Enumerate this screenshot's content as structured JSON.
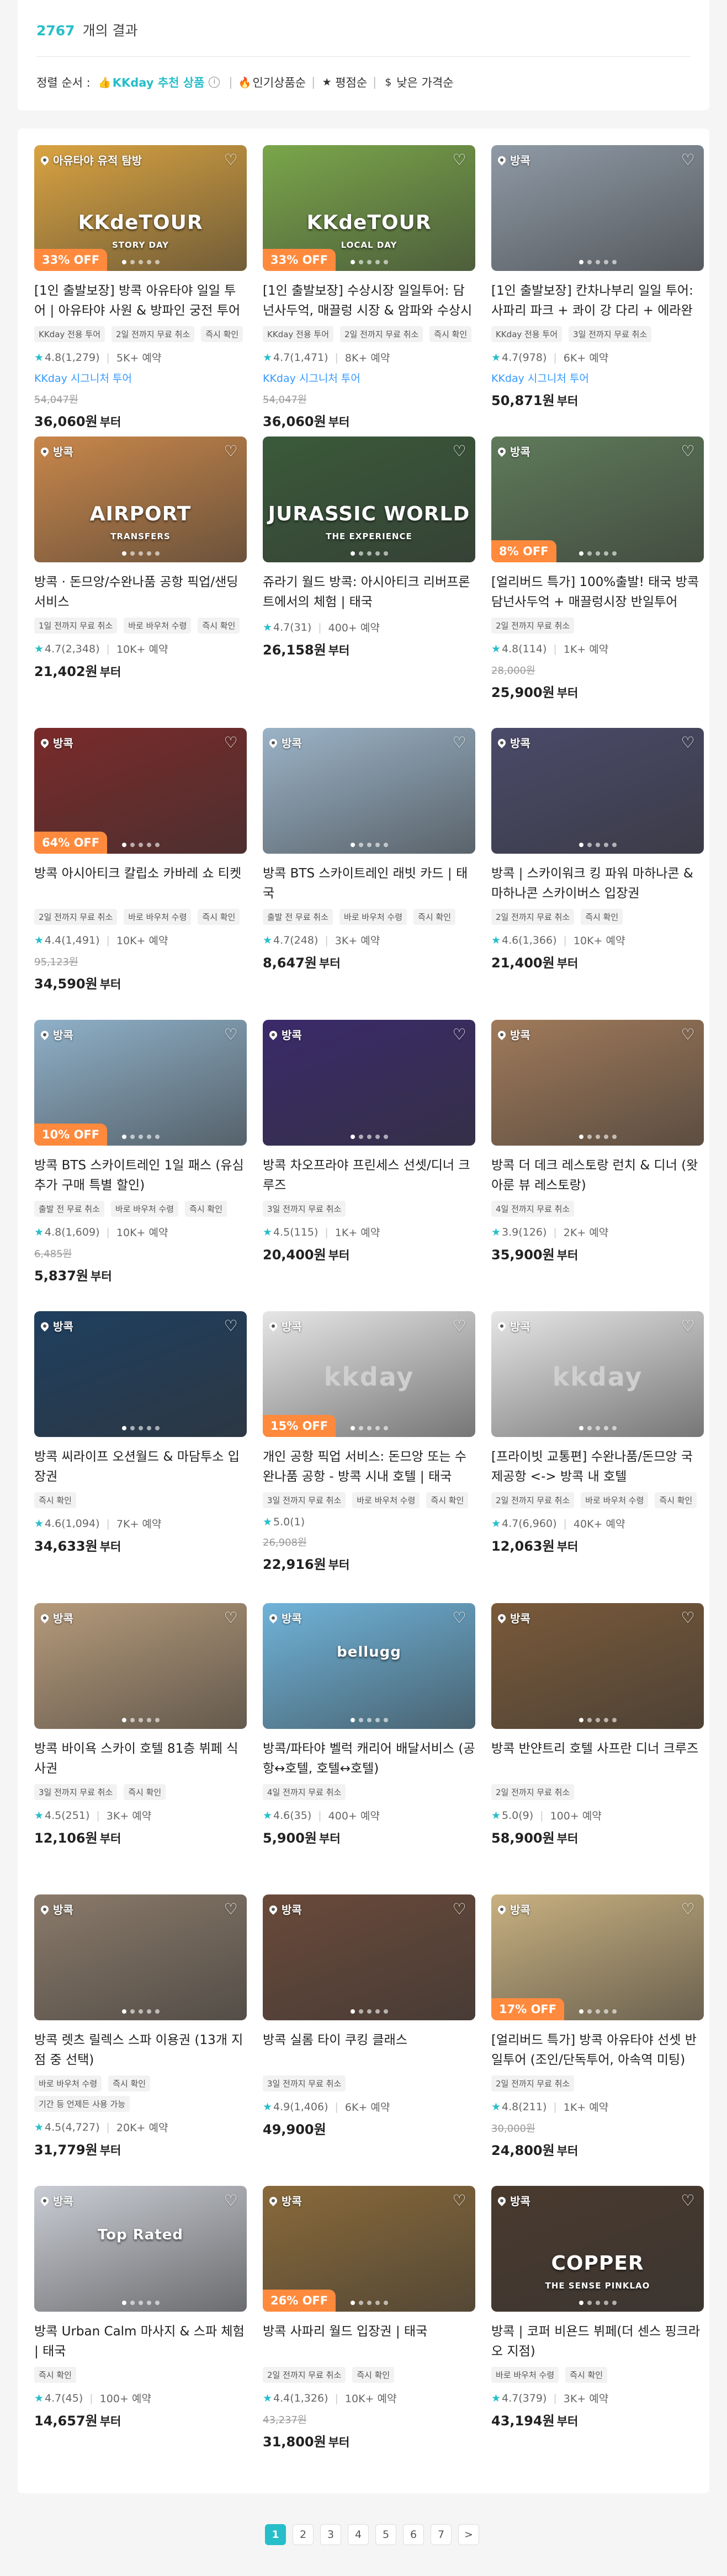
{
  "results": {
    "count": "2767",
    "label": "개의 결과"
  },
  "sort": {
    "label": "정렬 순서 :",
    "options": [
      {
        "label": "KKday 추천 상품",
        "glyph": "👍",
        "active": true
      },
      {
        "label": "인기상품순",
        "glyph": "🔥"
      },
      {
        "label": "평점순",
        "glyph": "★"
      },
      {
        "label": "낮은 가격순",
        "glyph": "$"
      }
    ]
  },
  "colors": {
    "accent": "#26bec9",
    "signature": "#3399ff",
    "discount": "#ff8a3d"
  },
  "products": [
    {
      "loc": "아유타야 유적 탐방",
      "off": "33% OFF",
      "img_text": "KKdeTOUR",
      "img_sub": "STORY DAY",
      "bg": "#d9a341",
      "title": "[1인 출발보장] 방콕 아유타야 일일 투어 | 아유타야 사원 & 방파인 궁전 투어",
      "tags": [
        "KKday 전용 투어",
        "2일 전까지 무료 취소",
        "즉시 확인"
      ],
      "rating": "4.8(1,279)",
      "booked": "5K+ 예약",
      "signature": "KKday 시그니처 투어",
      "old_price": "54,047원",
      "price": "36,060원",
      "unit": "부터"
    },
    {
      "loc": "",
      "off": "33% OFF",
      "img_text": "KKdeTOUR",
      "img_sub": "LOCAL DAY",
      "bg": "#7aa64a",
      "title": "[1인 출발보장] 수상시장 일일투어: 담넌사두억, 매끌렁 시장 & 암파와 수상시장",
      "tags": [
        "KKday 전용 투어",
        "2일 전까지 무료 취소",
        "즉시 확인"
      ],
      "rating": "4.7(1,471)",
      "booked": "8K+ 예약",
      "signature": "KKday 시그니처 투어",
      "old_price": "54,047원",
      "price": "36,060원",
      "unit": "부터"
    },
    {
      "loc": "방콕",
      "off": "",
      "img_text": "",
      "img_sub": "",
      "bg": "#8f9aa6",
      "title": "[1인 출발보장] 칸차나부리 일일 투어: 사파리 파크 + 콰이 강 다리 + 에라완 폭포",
      "tags": [
        "KKday 전용 투어",
        "3일 전까지 무료 취소"
      ],
      "rating": "4.7(978)",
      "booked": "6K+ 예약",
      "signature": "KKday 시그니처 투어",
      "old_price": "",
      "price": "50,871원",
      "unit": "부터"
    },
    {
      "loc": "방콕",
      "off": "",
      "img_text": "AIRPORT",
      "img_sub": "TRANSFERS",
      "bg": "#c9874a",
      "title": "방콕 · 돈므앙/수완나품 공항 픽업/샌딩 서비스",
      "tags": [
        "1일 전까지 무료 취소",
        "바로 바우처 수령",
        "즉시 확인"
      ],
      "rating": "4.7(2,348)",
      "booked": "10K+ 예약",
      "signature": "",
      "old_price": "",
      "price": "21,402원",
      "unit": "부터"
    },
    {
      "loc": "",
      "off": "",
      "img_text": "JURASSIC WORLD",
      "img_sub": "THE EXPERIENCE",
      "bg": "#3a5a3a",
      "title": "쥬라기 월드 방콕: 아시아티크 리버프론트에서의 체험 | 태국",
      "tags": [],
      "rating": "4.7(31)",
      "booked": "400+ 예약",
      "signature": "",
      "old_price": "",
      "price": "26,158원",
      "unit": "부터"
    },
    {
      "loc": "방콕",
      "off": "8% OFF",
      "img_text": "",
      "img_sub": "",
      "bg": "#5f7a5a",
      "title": "[얼리버드 특가] 100%출발! 태국 방콕 담넌사두억 + 매끌렁시장 반일투어",
      "tags": [
        "2일 전까지 무료 취소"
      ],
      "rating": "4.8(114)",
      "booked": "1K+ 예약",
      "signature": "",
      "old_price": "28,000원",
      "price": "25,900원",
      "unit": "부터"
    },
    {
      "loc": "방콕",
      "off": "64% OFF",
      "img_text": "",
      "img_sub": "",
      "bg": "#7a2a2a",
      "title": "방콕 아시아티크 칼립소 카바레 쇼 티켓",
      "tags": [
        "2일 전까지 무료 취소",
        "바로 바우처 수령",
        "즉시 확인"
      ],
      "rating": "4.4(1,491)",
      "booked": "10K+ 예약",
      "signature": "",
      "old_price": "95,123원",
      "price": "34,590원",
      "unit": "부터"
    },
    {
      "loc": "방콕",
      "off": "",
      "img_text": "",
      "img_sub": "",
      "bg": "#9bb3c7",
      "title": "방콕 BTS 스카이트레인 래빗 카드 | 태국",
      "tags": [
        "출발 전 무료 취소",
        "바로 바우처 수령",
        "즉시 확인"
      ],
      "rating": "4.7(248)",
      "booked": "3K+ 예약",
      "signature": "",
      "old_price": "",
      "price": "8,647원",
      "unit": "부터"
    },
    {
      "loc": "방콕",
      "off": "",
      "img_text": "",
      "img_sub": "",
      "bg": "#4a4a6a",
      "title": "방콕 | 스카이워크 킹 파워 마하나콘 & 마하나콘 스카이버스 입장권",
      "tags": [
        "2일 전까지 무료 취소",
        "즉시 확인"
      ],
      "rating": "4.6(1,366)",
      "booked": "10K+ 예약",
      "signature": "",
      "old_price": "",
      "price": "21,400원",
      "unit": "부터"
    },
    {
      "loc": "방콕",
      "off": "10% OFF",
      "img_text": "",
      "img_sub": "",
      "bg": "#8fb0c8",
      "title": "방콕 BTS 스카이트레인 1일 패스 (유심 추가 구매 특별 할인)",
      "tags": [
        "출발 전 무료 취소",
        "바로 바우처 수령",
        "즉시 확인"
      ],
      "rating": "4.8(1,609)",
      "booked": "10K+ 예약",
      "signature": "",
      "old_price": "6,485원",
      "price": "5,837원",
      "unit": "부터"
    },
    {
      "loc": "방콕",
      "off": "",
      "img_text": "",
      "img_sub": "",
      "bg": "#3a2a6a",
      "title": "방콕 차오프라야 프린세스 선셋/디너 크루즈",
      "tags": [
        "3일 전까지 무료 취소"
      ],
      "rating": "4.5(115)",
      "booked": "1K+ 예약",
      "signature": "",
      "old_price": "",
      "price": "20,400원",
      "unit": "부터"
    },
    {
      "loc": "방콕",
      "off": "",
      "img_text": "",
      "img_sub": "",
      "bg": "#a07a5a",
      "title": "방콕 더 데크 레스토랑 런치 & 디너 (왓아룬 뷰 레스토랑)",
      "tags": [
        "4일 전까지 무료 취소"
      ],
      "rating": "3.9(126)",
      "booked": "2K+ 예약",
      "signature": "",
      "old_price": "",
      "price": "35,900원",
      "unit": "부터"
    },
    {
      "loc": "방콕",
      "off": "",
      "img_text": "",
      "img_sub": "",
      "bg": "#1f3f5f",
      "title": "방콕 씨라이프 오션월드 & 마담투소 입장권",
      "tags": [
        "즉시 확인"
      ],
      "rating": "4.6(1,094)",
      "booked": "7K+ 예약",
      "signature": "",
      "old_price": "",
      "price": "34,633원",
      "unit": "부터"
    },
    {
      "loc": "방콕",
      "off": "15% OFF",
      "img_text": "kkday",
      "img_sub": "",
      "bg": "#e6e6e6",
      "title": "개인 공항 픽업 서비스: 돈므앙 또는 수완나품 공항 - 방콕 시내 호텔 | 태국",
      "tags": [
        "3일 전까지 무료 취소",
        "바로 바우처 수령",
        "즉시 확인"
      ],
      "rating": "5.0(1)",
      "booked": "",
      "signature": "",
      "old_price": "26,908원",
      "price": "22,916원",
      "unit": "부터"
    },
    {
      "loc": "방콕",
      "off": "",
      "img_text": "kkday",
      "img_sub": "",
      "bg": "#e6e6e6",
      "title": "[프라이빗 교통편] 수완나품/돈므앙 국제공항 <-> 방콕 내 호텔",
      "tags": [
        "2일 전까지 무료 취소",
        "바로 바우처 수령",
        "즉시 확인"
      ],
      "rating": "4.7(6,960)",
      "booked": "40K+ 예약",
      "signature": "",
      "old_price": "",
      "price": "12,063원",
      "unit": "부터"
    },
    {
      "loc": "방콕",
      "off": "",
      "img_text": "",
      "img_sub": "",
      "bg": "#b59a7a",
      "title": "방콕 바이욕 스카이 호텔 81층 뷔페 식사권",
      "tags": [
        "3일 전까지 무료 취소",
        "즉시 확인"
      ],
      "rating": "4.5(251)",
      "booked": "3K+ 예약",
      "signature": "",
      "old_price": "",
      "price": "12,106원",
      "unit": "부터"
    },
    {
      "loc": "방콕",
      "off": "",
      "img_text": "bellugg",
      "img_sub": "",
      "bg": "#6fb3d9",
      "title": "방콕/파타야 벨럭 캐리어 배달서비스 (공항↔호텔, 호텔↔호텔)",
      "tags": [
        "4일 전까지 무료 취소"
      ],
      "rating": "4.6(35)",
      "booked": "400+ 예약",
      "signature": "",
      "old_price": "",
      "price": "5,900원",
      "unit": "부터"
    },
    {
      "loc": "방콕",
      "off": "",
      "img_text": "",
      "img_sub": "",
      "bg": "#7a5a3a",
      "title": "방콕 반얀트리 호텔 사프란 디너 크루즈",
      "tags": [
        "2일 전까지 무료 취소"
      ],
      "rating": "5.0(9)",
      "booked": "100+ 예약",
      "signature": "",
      "old_price": "",
      "price": "58,900원",
      "unit": "부터"
    },
    {
      "loc": "방콕",
      "off": "",
      "img_text": "",
      "img_sub": "",
      "bg": "#8a7a6a",
      "title": "방콕 렛츠 릴렉스 스파 이용권 (13개 지점 중 선택)",
      "tags": [
        "바로 바우처 수령",
        "즉시 확인",
        "기간 등 언제든 사용 가능"
      ],
      "rating": "4.5(4,727)",
      "booked": "20K+ 예약",
      "signature": "",
      "old_price": "",
      "price": "31,779원",
      "unit": "부터"
    },
    {
      "loc": "방콕",
      "off": "",
      "img_text": "",
      "img_sub": "",
      "bg": "#6a4a3a",
      "title": "방콕 실롬 타이 쿠킹 클래스",
      "tags": [
        "3일 전까지 무료 취소"
      ],
      "rating": "4.9(1,406)",
      "booked": "6K+ 예약",
      "signature": "",
      "old_price": "",
      "price": "49,900원",
      "unit": ""
    },
    {
      "loc": "방콕",
      "off": "17% OFF",
      "img_text": "",
      "img_sub": "",
      "bg": "#c8b080",
      "title": "[얼리버드 특가] 방콕 아유타야 선셋 반일투어 (조인/단독투어, 아속역 미팅)",
      "tags": [
        "2일 전까지 무료 취소"
      ],
      "rating": "4.8(211)",
      "booked": "1K+ 예약",
      "signature": "",
      "old_price": "30,000원",
      "price": "24,800원",
      "unit": "부터"
    },
    {
      "loc": "방콕",
      "off": "",
      "img_text": "Top Rated",
      "img_sub": "",
      "bg": "#c9ccd3",
      "title": "방콕 Urban Calm 마사지 & 스파 체험 | 태국",
      "tags": [
        "즉시 확인"
      ],
      "rating": "4.7(45)",
      "booked": "100+ 예약",
      "signature": "",
      "old_price": "",
      "price": "14,657원",
      "unit": "부터"
    },
    {
      "loc": "방콕",
      "off": "26% OFF",
      "img_text": "",
      "img_sub": "",
      "bg": "#8a6a3a",
      "title": "방콕 사파리 월드 입장권 | 태국",
      "tags": [
        "2일 전까지 무료 취소",
        "즉시 확인"
      ],
      "rating": "4.4(1,326)",
      "booked": "10K+ 예약",
      "signature": "",
      "old_price": "43,237원",
      "price": "31,800원",
      "unit": "부터"
    },
    {
      "loc": "방콕",
      "off": "",
      "img_text": "COPPER",
      "img_sub": "THE SENSE PINKLAO",
      "bg": "#4a3a2e",
      "title": "방콕 | 코퍼 비욘드 뷔페(더 센스 핑크라오 지점)",
      "tags": [
        "바로 바우처 수령",
        "즉시 확인"
      ],
      "rating": "4.7(379)",
      "booked": "3K+ 예약",
      "signature": "",
      "old_price": "",
      "price": "43,194원",
      "unit": "부터"
    }
  ],
  "pagination": [
    "1",
    "2",
    "3",
    "4",
    "5",
    "6",
    "7",
    ">"
  ]
}
